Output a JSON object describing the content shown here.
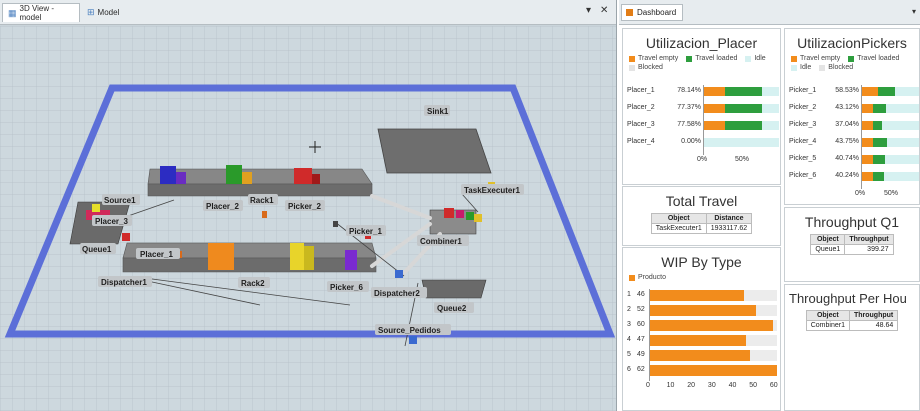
{
  "tabs": {
    "view_label": "3D View - model",
    "model_label": "Model",
    "pin_glyph": "▾",
    "close_glyph": "✕",
    "dashboard_label": "Dashboard",
    "dashboard_menu_glyph": "▾"
  },
  "scene": {
    "labels": {
      "sink1": "Sink1",
      "task_executer1": "TaskExecuter1",
      "source1": "Source1",
      "placer_3": "Placer_3",
      "placer_2": "Placer_2",
      "rack1": "Rack1",
      "picker_2": "Picker_2",
      "picker_1": "Picker_1",
      "combiner1": "Combiner1",
      "queue1": "Queue1",
      "placer_1": "Placer_1",
      "dispatcher1": "Dispatcher1",
      "rack2": "Rack2",
      "picker_6": "Picker_6",
      "dispatcher2": "Dispatcher2",
      "queue2": "Queue2",
      "source_pedidos": "Source_Pedidos"
    }
  },
  "colors": {
    "travel_empty": "#f28c1c",
    "travel_loaded": "#2e9e3e",
    "idle": "#d6f1f1",
    "blocked": "#e4e4e4",
    "scene_border": "#5c6fd8"
  },
  "widgets": {
    "util_placer": {
      "title": "Utilizacion_Placer",
      "legend": [
        "Travel empty",
        "Travel loaded",
        "Idle",
        "Blocked"
      ],
      "rows": [
        {
          "name": "Placer_1",
          "pct": "78.14%",
          "empty": 0.29,
          "loaded": 0.49
        },
        {
          "name": "Placer_2",
          "pct": "77.37%",
          "empty": 0.29,
          "loaded": 0.48
        },
        {
          "name": "Placer_3",
          "pct": "77.58%",
          "empty": 0.29,
          "loaded": 0.49
        },
        {
          "name": "Placer_4",
          "pct": "0.00%",
          "empty": 0.0,
          "loaded": 0.0
        }
      ],
      "ticks": [
        "0%",
        "50%"
      ]
    },
    "util_pickers": {
      "title": "UtilizacionPickers",
      "legend": [
        "Travel empty",
        "Travel loaded",
        "Idle",
        "Blocked"
      ],
      "rows": [
        {
          "name": "Picker_1",
          "pct": "58.53%",
          "empty": 0.3,
          "loaded": 0.29
        },
        {
          "name": "Picker_2",
          "pct": "43.12%",
          "empty": 0.2,
          "loaded": 0.23
        },
        {
          "name": "Picker_3",
          "pct": "37.04%",
          "empty": 0.2,
          "loaded": 0.17
        },
        {
          "name": "Picker_4",
          "pct": "43.75%",
          "empty": 0.2,
          "loaded": 0.24
        },
        {
          "name": "Picker_5",
          "pct": "40.74%",
          "empty": 0.21,
          "loaded": 0.2
        },
        {
          "name": "Picker_6",
          "pct": "40.24%",
          "empty": 0.2,
          "loaded": 0.2
        }
      ],
      "ticks": [
        "0%",
        "50%"
      ]
    },
    "total_travel": {
      "title": "Total Travel",
      "headers": [
        "Object",
        "Distance"
      ],
      "rows": [
        [
          "TaskExecuter1",
          "1933117.62"
        ]
      ]
    },
    "throughput_q1": {
      "title": "Throughput Q1",
      "headers": [
        "Object",
        "Throughput"
      ],
      "rows": [
        [
          "Queue1",
          "399.27"
        ]
      ]
    },
    "wip": {
      "title": "WIP By Type",
      "legend": "Producto",
      "rows": [
        {
          "idx": "1",
          "value": 46
        },
        {
          "idx": "2",
          "value": 52
        },
        {
          "idx": "3",
          "value": 60
        },
        {
          "idx": "4",
          "value": 47
        },
        {
          "idx": "5",
          "value": 49
        },
        {
          "idx": "6",
          "value": 62
        }
      ],
      "xmax": 62,
      "ticks": [
        "0",
        "10",
        "20",
        "30",
        "40",
        "50",
        "60"
      ]
    },
    "throughput_per_hour": {
      "title": "Throughput Per Hou",
      "headers": [
        "Object",
        "Throughput"
      ],
      "rows": [
        [
          "Combiner1",
          "48.64"
        ]
      ]
    }
  }
}
